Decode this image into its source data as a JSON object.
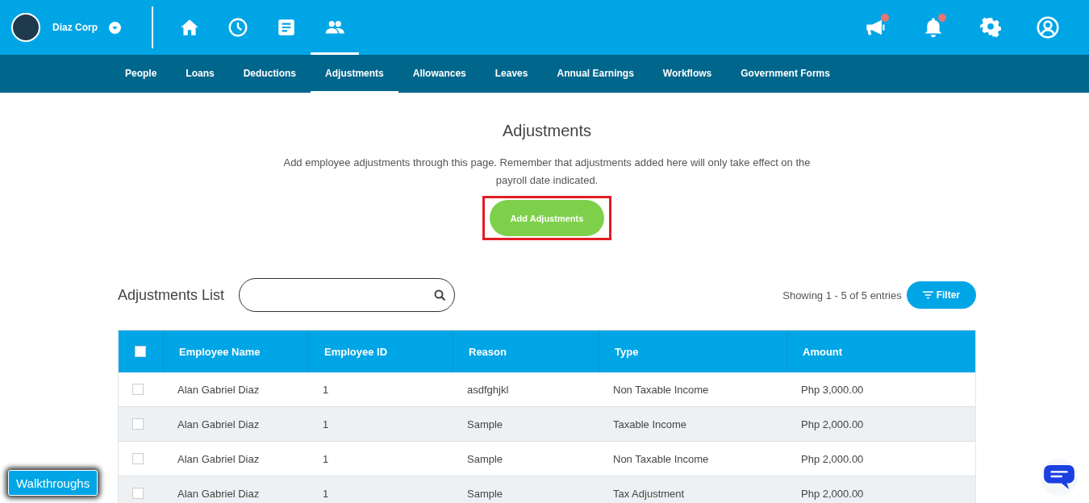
{
  "header": {
    "company": "Diaz Corp",
    "nav_icons": [
      {
        "kind": "home",
        "selected": false
      },
      {
        "kind": "clock",
        "selected": false
      },
      {
        "kind": "document",
        "selected": false
      },
      {
        "kind": "people",
        "selected": true
      }
    ],
    "actions": [
      {
        "kind": "megaphone",
        "badge": true
      },
      {
        "kind": "bell",
        "badge": true
      },
      {
        "kind": "gear",
        "badge": false
      },
      {
        "kind": "user",
        "badge": false
      }
    ]
  },
  "tabs": [
    {
      "label": "People",
      "selected": false
    },
    {
      "label": "Loans",
      "selected": false
    },
    {
      "label": "Deductions",
      "selected": false
    },
    {
      "label": "Adjustments",
      "selected": true
    },
    {
      "label": "Allowances",
      "selected": false
    },
    {
      "label": "Leaves",
      "selected": false
    },
    {
      "label": "Annual Earnings",
      "selected": false
    },
    {
      "label": "Workflows",
      "selected": false
    },
    {
      "label": "Government Forms",
      "selected": false
    }
  ],
  "page": {
    "title": "Adjustments",
    "description": "Add employee adjustments through this page. Remember that adjustments added here will only take effect on the payroll date indicated.",
    "add_button": "Add Adjustments",
    "add_button_highlighted": true
  },
  "list": {
    "title": "Adjustments List",
    "entries": "Showing 1 - 5 of 5 entries",
    "filter": "Filter"
  },
  "table": {
    "select_all": {
      "checked": false
    },
    "columns": [
      "Employee Name",
      "Employee ID",
      "Reason",
      "Type",
      "Amount"
    ],
    "rows": [
      {
        "checked": false,
        "cells": [
          "Alan Gabriel Diaz",
          "1",
          "asdfghjkl",
          "Non Taxable Income",
          "Php 3,000.00"
        ]
      },
      {
        "checked": false,
        "cells": [
          "Alan Gabriel Diaz",
          "1",
          "Sample",
          "Taxable Income",
          "Php 2,000.00"
        ]
      },
      {
        "checked": false,
        "cells": [
          "Alan Gabriel Diaz",
          "1",
          "Sample",
          "Non Taxable Income",
          "Php 2,000.00"
        ]
      },
      {
        "checked": false,
        "cells": [
          "Alan Gabriel Diaz",
          "1",
          "Sample",
          "Tax Adjustment",
          "Php 2,000.00"
        ]
      }
    ]
  },
  "walkthroughs": "Walkthroughs"
}
